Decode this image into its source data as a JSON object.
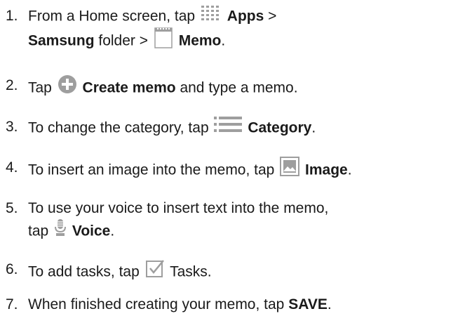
{
  "steps": [
    {
      "number": "1.",
      "line1_a": "From a Home screen, tap",
      "apps_label": "Apps",
      "line1_b": ">",
      "samsung_label": "Samsung",
      "line2_a": "folder >",
      "memo_label": "Memo",
      "line2_end": "."
    },
    {
      "number": "2.",
      "text_a": "Tap",
      "create_label": "Create memo",
      "text_b": "and type a memo."
    },
    {
      "number": "3.",
      "text_a": "To change the category, tap",
      "category_label": "Category",
      "text_end": "."
    },
    {
      "number": "4.",
      "text_a": "To insert an image into the memo, tap",
      "image_label": "Image",
      "text_end": "."
    },
    {
      "number": "5.",
      "line1": "To use your voice to insert text into the memo,",
      "line2_a": "tap",
      "voice_label": "Voice",
      "text_end": "."
    },
    {
      "number": "6.",
      "text_a": "To add tasks, tap",
      "tasks_label": "Tasks."
    },
    {
      "number": "7.",
      "text_a": "When finished creating your memo, tap",
      "save_label": "SAVE",
      "text_end": "."
    }
  ],
  "icons": {
    "apps": "apps-grid-icon",
    "memo": "memo-notepad-icon",
    "create": "add-circle-icon",
    "category": "category-list-icon",
    "image": "image-icon",
    "voice": "microphone-icon",
    "tasks": "checkbox-icon"
  },
  "colors": {
    "icon_gray": "#9e9e9e",
    "text": "#1a1a1a"
  }
}
